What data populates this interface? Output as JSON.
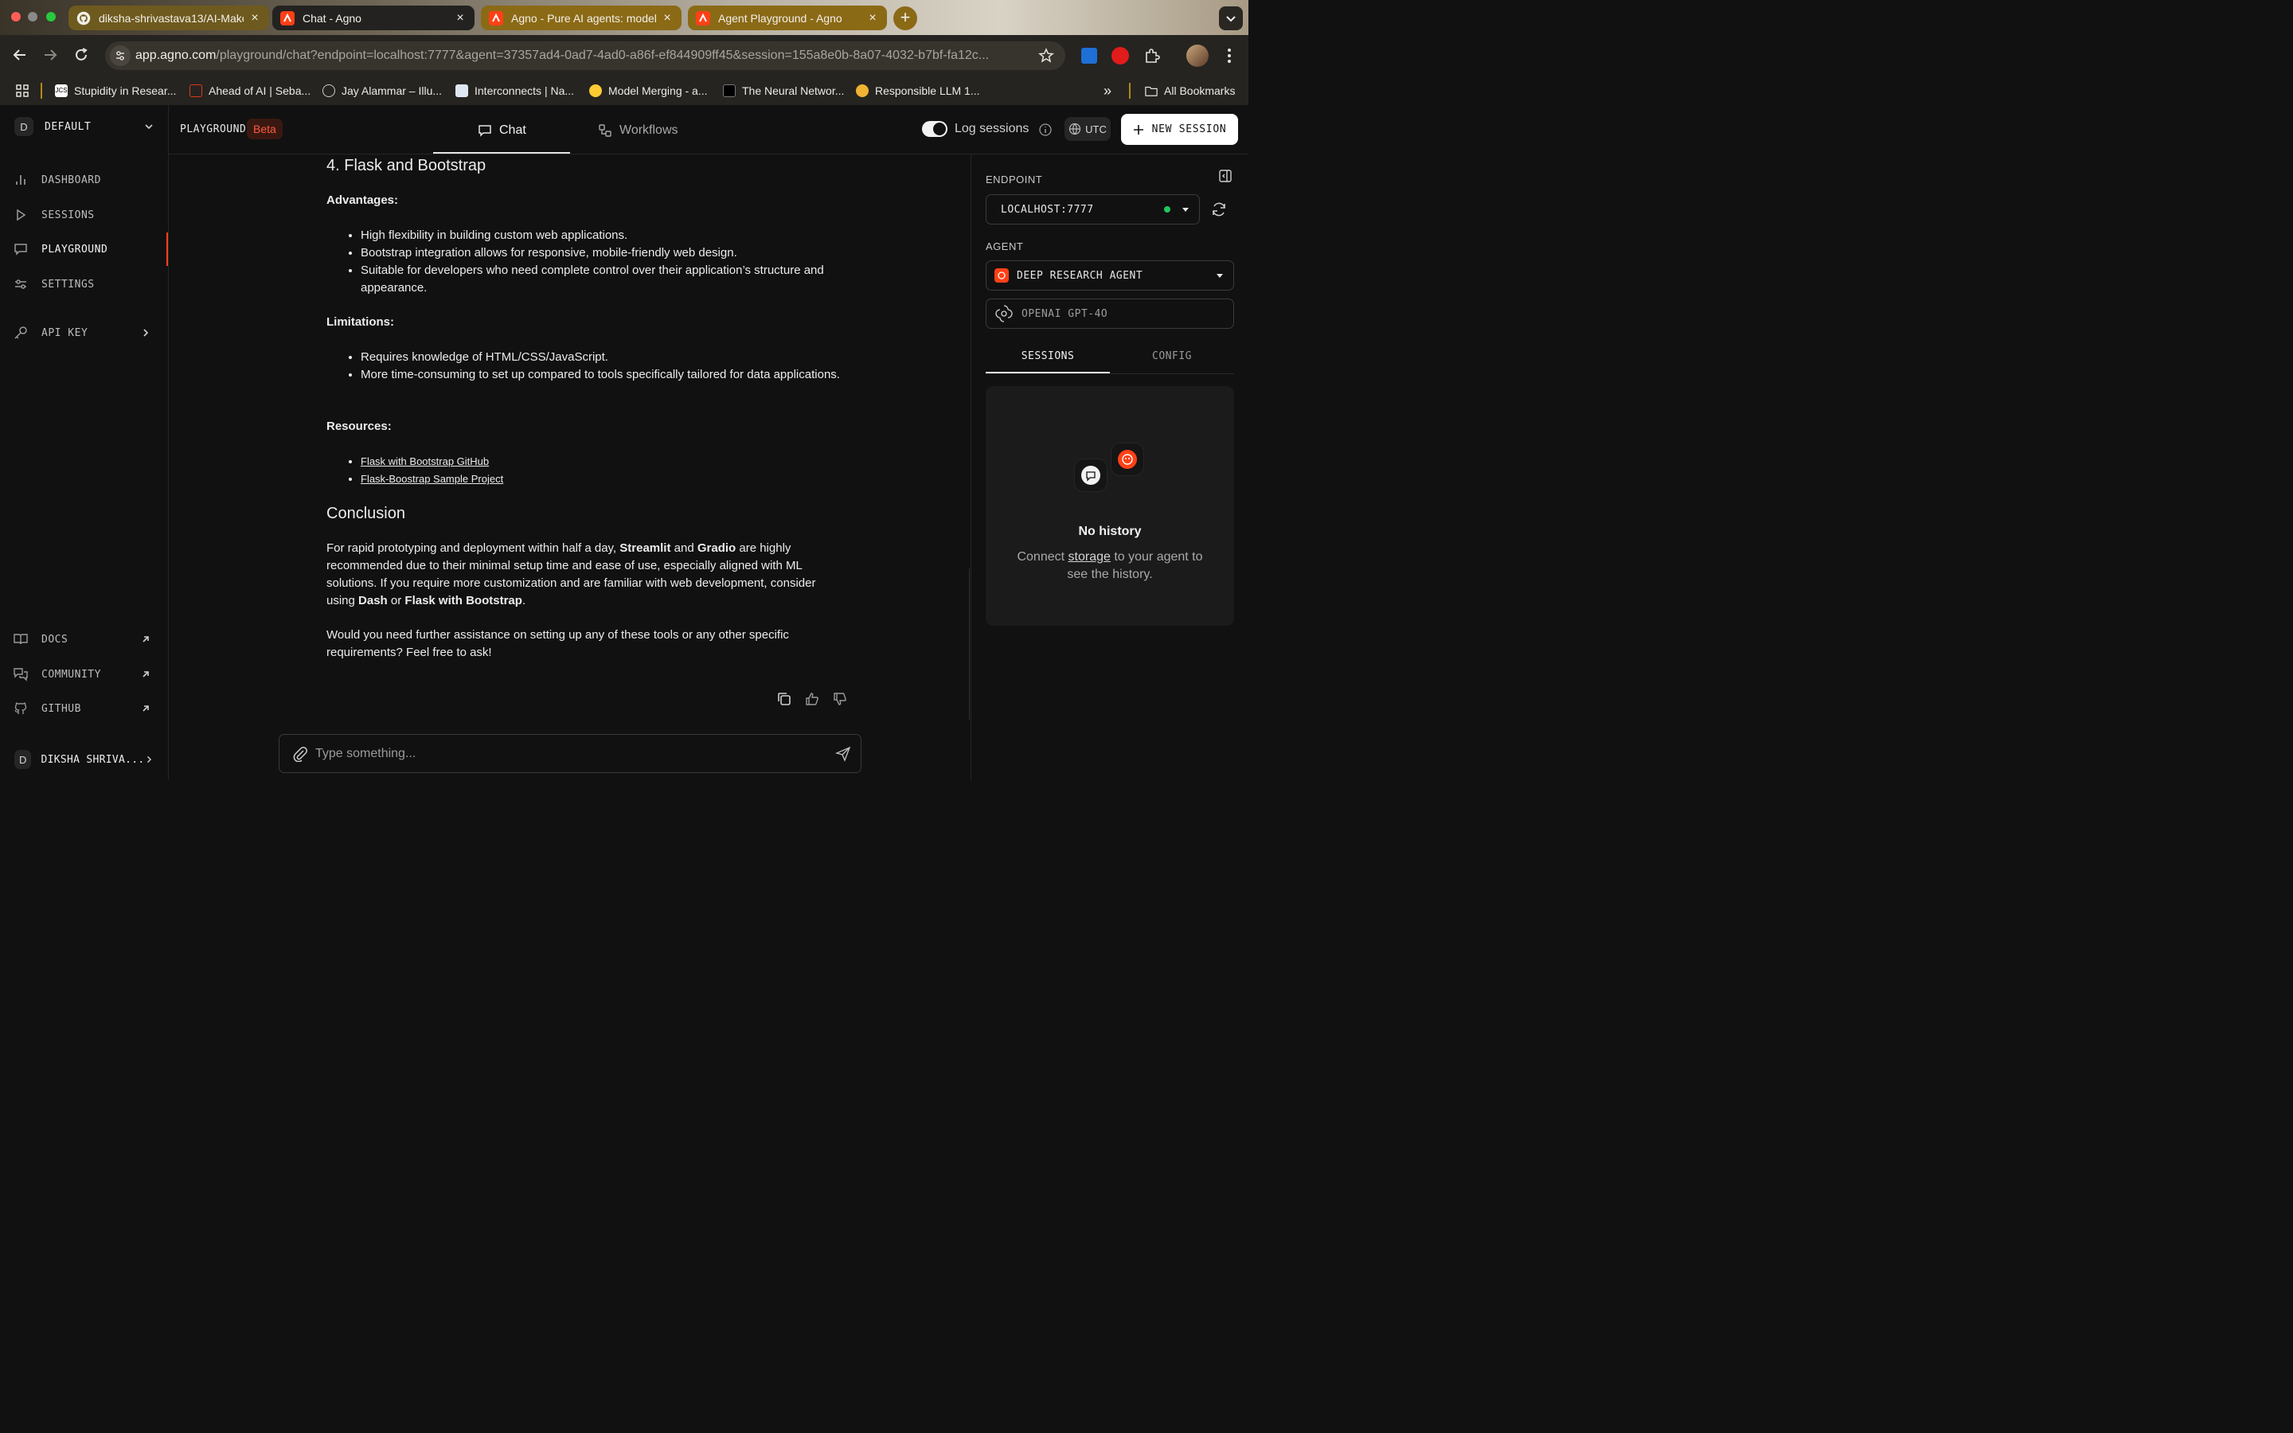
{
  "browser": {
    "tabs": [
      {
        "title": "diksha-shrivastava13/AI-Make",
        "favicon": "github-icon"
      },
      {
        "title": "Chat - Agno",
        "favicon": "agno-icon",
        "active": true
      },
      {
        "title": "Agno - Pure AI agents: model",
        "favicon": "agno-icon"
      },
      {
        "title": "Agent Playground - Agno",
        "favicon": "agno-icon"
      }
    ],
    "url_host": "app.agno.com",
    "url_rest": "/playground/chat?endpoint=localhost:7777&agent=37357ad4-0ad7-4ad0-a86f-ef844909ff45&session=155a8e0b-8a07-4032-b7bf-fa12c...",
    "bookmarks": [
      "Stupidity in Resear...",
      "Ahead of AI | Seba...",
      "Jay Alammar – Illu...",
      "Interconnects | Na...",
      "Model Merging - a...",
      "The Neural Networ...",
      "Responsible LLM 1..."
    ],
    "all_bookmarks": "All Bookmarks"
  },
  "sidebar": {
    "workspace_initial": "D",
    "workspace_name": "DEFAULT",
    "items": [
      {
        "label": "DASHBOARD",
        "icon": "bar-chart-icon"
      },
      {
        "label": "SESSIONS",
        "icon": "play-icon"
      },
      {
        "label": "PLAYGROUND",
        "icon": "message-square-icon",
        "active": true
      },
      {
        "label": "SETTINGS",
        "icon": "sliders-icon"
      },
      {
        "label": "API KEY",
        "icon": "key-icon"
      }
    ],
    "bottom_items": [
      {
        "label": "DOCS",
        "icon": "book-icon"
      },
      {
        "label": "COMMUNITY",
        "icon": "chat-bubbles-icon"
      },
      {
        "label": "GITHUB",
        "icon": "github-icon"
      }
    ],
    "user_initial": "D",
    "user_name": "DIKSHA SHRIVA..."
  },
  "header": {
    "playground_label": "PLAYGROUND",
    "beta_badge": "Beta",
    "tabs": [
      "Chat",
      "Workflows"
    ],
    "log_sessions_label": "Log sessions",
    "log_sessions_on": true,
    "timezone": "UTC",
    "new_session_label": "NEW SESSION"
  },
  "message": {
    "heading_flask": "4. Flask and Bootstrap",
    "advantages_label": "Advantages:",
    "advantages": [
      "High flexibility in building custom web applications.",
      "Bootstrap integration allows for responsive, mobile-friendly web design.",
      "Suitable for developers who need complete control over their application’s structure and appearance."
    ],
    "limitations_label": "Limitations:",
    "limitations": [
      "Requires knowledge of HTML/CSS/JavaScript.",
      "More time-consuming to set up compared to tools specifically tailored for data applications."
    ],
    "resources_label": "Resources:",
    "resources": [
      "Flask with Bootstrap GitHub",
      "Flask-Boostrap Sample Project"
    ],
    "conclusion_heading": "Conclusion",
    "conclusion": {
      "p1": "For rapid prototyping and deployment within half a day, ",
      "b1": "Streamlit",
      "p2": " and ",
      "b2": "Gradio",
      "p3": " are highly recommended due to their minimal setup time and ease of use, especially aligned with ML solutions. If you require more customization and are familiar with web development, consider using ",
      "b3": "Dash",
      "p4": " or ",
      "b4": "Flask with Bootstrap",
      "p5": "."
    },
    "closing": "Would you need further assistance on setting up any of these tools or any other specific requirements? Feel free to ask!"
  },
  "composer": {
    "placeholder": "Type something..."
  },
  "right_panel": {
    "endpoint_label": "ENDPOINT",
    "endpoint_value": "LOCALHOST:7777",
    "endpoint_status_color": "#22c55e",
    "agent_label": "AGENT",
    "agent_value": "DEEP RESEARCH AGENT",
    "model_value": "OPENAI GPT-4O",
    "tabs": [
      "SESSIONS",
      "CONFIG"
    ],
    "empty_title": "No history",
    "empty_text_1": "Connect ",
    "empty_link": "storage",
    "empty_text_2": " to your agent to see the history."
  },
  "colors": {
    "accent": "#ff4017",
    "background": "#111111"
  }
}
